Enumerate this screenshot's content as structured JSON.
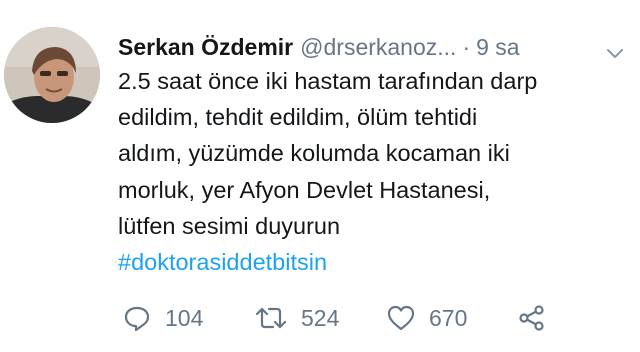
{
  "user": {
    "display_name": "Serkan Özdemir",
    "handle": "@drserkanoz...",
    "time": "9 sa",
    "separator": "·"
  },
  "tweet": {
    "lines": [
      "2.5 saat önce iki hastam tarafından darp",
      "edildim, tehdit edildim, ölüm tehtidi",
      "aldım, yüzümde kolumda kocaman iki",
      "morluk, yer Afyon Devlet Hastanesi,",
      "lütfen sesimi duyurun"
    ],
    "hashtag": "#doktorasiddetbitsin"
  },
  "actions": {
    "reply_count": "104",
    "retweet_count": "524",
    "like_count": "670"
  },
  "icons": {
    "reply": "reply-icon",
    "retweet": "retweet-icon",
    "like": "heart-icon",
    "share": "share-icon",
    "menu": "chevron-down-icon"
  },
  "colors": {
    "text": "#14171a",
    "secondary": "#657786",
    "link": "#1da1f2"
  }
}
